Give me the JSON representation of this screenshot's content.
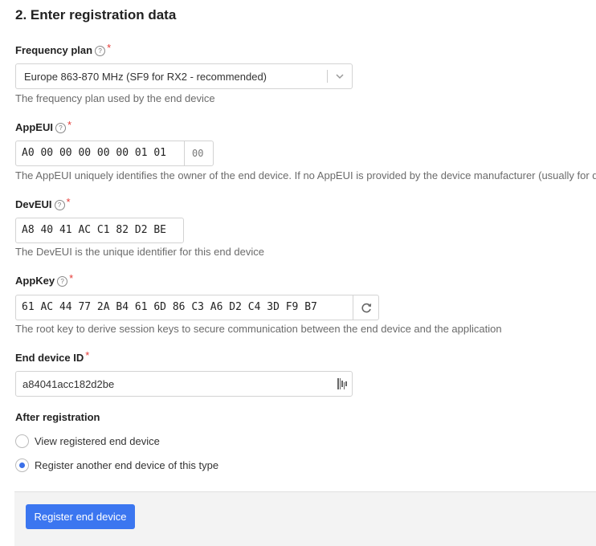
{
  "section_title": "2. Enter registration data",
  "frequency_plan": {
    "label": "Frequency plan",
    "selected": "Europe 863-870 MHz (SF9 for RX2 - recommended)",
    "description": "The frequency plan used by the end device"
  },
  "app_eui": {
    "label": "AppEUI",
    "value": "A0 00 00 00 00 00 01 01",
    "suffix": "00",
    "description": "The AppEUI uniquely identifies the owner of the end device. If no AppEUI is provided by the device manufacturer (usually for d"
  },
  "dev_eui": {
    "label": "DevEUI",
    "value": "A8 40 41 AC C1 82 D2 BE",
    "description": "The DevEUI is the unique identifier for this end device"
  },
  "app_key": {
    "label": "AppKey",
    "value": "61 AC 44 77 2A B4 61 6D 86 C3 A6 D2 C4 3D F9 B7",
    "description": "The root key to derive session keys to secure communication between the end device and the application"
  },
  "end_device_id": {
    "label": "End device ID",
    "value": "a84041acc182d2be"
  },
  "after_registration": {
    "label": "After registration",
    "options": [
      {
        "label": "View registered end device",
        "selected": false
      },
      {
        "label": "Register another end device of this type",
        "selected": true
      }
    ]
  },
  "submit_label": "Register end device",
  "colors": {
    "accent": "#3b76f0",
    "required": "#e53935"
  },
  "icons": {
    "help": "help-circle-icon",
    "dropdown": "chevron-down-icon",
    "refresh": "refresh-icon",
    "id": "barcode-icon"
  }
}
